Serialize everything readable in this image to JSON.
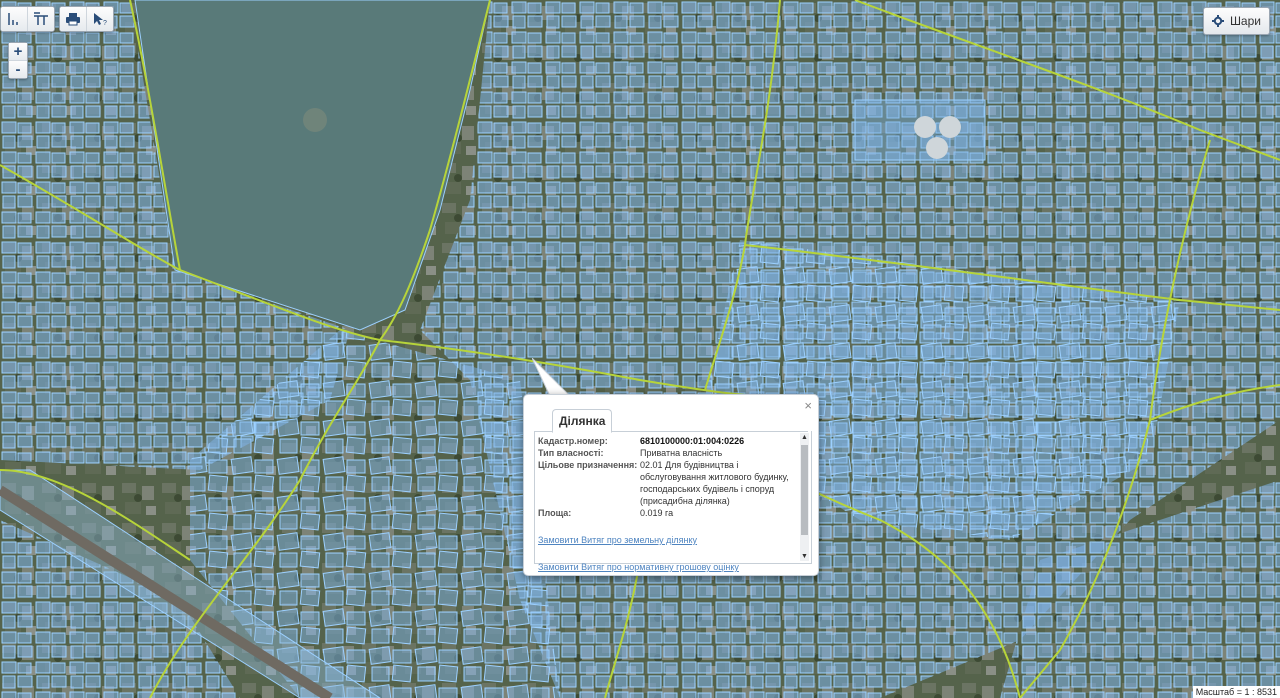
{
  "toolbar": {
    "groups": [
      [
        "measure-length-icon",
        "measure-area-icon"
      ],
      [
        "print-icon",
        "cursor-info-icon"
      ]
    ]
  },
  "zoom": {
    "in_label": "+",
    "out_label": "-"
  },
  "layers": {
    "label": "Шари",
    "icon": "gear-icon"
  },
  "popup": {
    "tab_label": "Ділянка",
    "close_label": "×",
    "fields": [
      {
        "label": "Кадастр.номер:",
        "value": "6810100000:01:004:0226"
      },
      {
        "label": "Тип власності:",
        "value": "Приватна власність"
      },
      {
        "label": "Цільове призначення:",
        "value": "02.01 Для будівництва і обслуговування житлового будинку, господарських будівель і споруд (присадибна ділянка)"
      },
      {
        "label": "Площа:",
        "value": "0.019 га"
      }
    ],
    "links": [
      "Замовити Витяг про земельну ділянку",
      "Замовити Витяг про нормативну грошову оцінку"
    ]
  },
  "scale": {
    "text": "Масштаб = 1 : 8531"
  },
  "colors": {
    "parcel_fill": "#7fb3e6",
    "parcel_stroke": "#8ec5ff",
    "boundary_line": "#b7d43a",
    "imagery_dark": "#4a5a44"
  }
}
